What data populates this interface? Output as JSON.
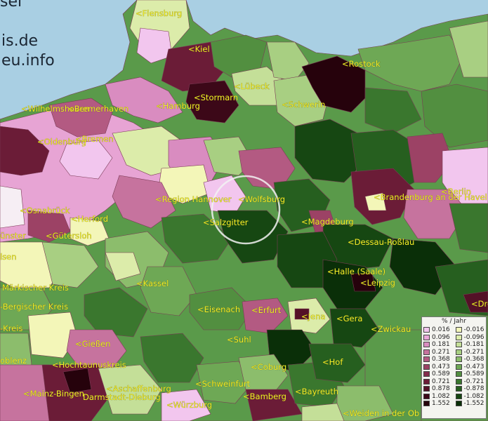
{
  "watermark": {
    "line1": "sel",
    "line2": "is.de",
    "line3": "eu.info"
  },
  "legend": {
    "title": "% / Jahr",
    "positive": [
      {
        "value": "0.016",
        "color": "#f2c6ee"
      },
      {
        "value": "0.096",
        "color": "#e8a6d8"
      },
      {
        "value": "0.181",
        "color": "#d98cc0"
      },
      {
        "value": "0.271",
        "color": "#c6739e"
      },
      {
        "value": "0.368",
        "color": "#b35a82"
      },
      {
        "value": "0.473",
        "color": "#9c4265"
      },
      {
        "value": "0.589",
        "color": "#842c4c"
      },
      {
        "value": "0.721",
        "color": "#6b1c37"
      },
      {
        "value": "0.878",
        "color": "#541127"
      },
      {
        "value": "1.082",
        "color": "#3c0818"
      },
      {
        "value": "1.552",
        "color": "#26020c"
      }
    ],
    "negative": [
      {
        "value": "-0.016",
        "color": "#f3f6b8"
      },
      {
        "value": "-0.096",
        "color": "#dcecaa"
      },
      {
        "value": "-0.181",
        "color": "#c4df98"
      },
      {
        "value": "-0.271",
        "color": "#a8cf82"
      },
      {
        "value": "-0.368",
        "color": "#8cbd6c"
      },
      {
        "value": "-0.473",
        "color": "#6ea855"
      },
      {
        "value": "-0.589",
        "color": "#528f40"
      },
      {
        "value": "-0.721",
        "color": "#3a772e"
      },
      {
        "value": "-0.878",
        "color": "#265f1f"
      },
      {
        "value": "-1.082",
        "color": "#164712"
      },
      {
        "value": "-1.552",
        "color": "#0a2f08"
      }
    ]
  },
  "cities": [
    "<Flensburg",
    "<Kiel",
    "<Rostock",
    "<Lübeck",
    "<Stormarn",
    "<Hamburg",
    "<Schwerin",
    "<Wilhelmshaven",
    "<Bremerhaven",
    "<Bremen",
    "<Oldenburg",
    "<Berlin",
    "<Region Hannover",
    "<Wolfsburg",
    "<Brandenburg an der Havel",
    "<Osnabrück",
    "<Herford",
    "<Salzgitter",
    "<Magdeburg",
    "ünster",
    "<Gütersloh",
    "<Dessau-Roßlau",
    "lsen",
    "<Halle (Saale)",
    "Märkischer Kreis",
    "<Kassel",
    "<Leipzig",
    "-Bergischer Kreis",
    "<Eisenach",
    "<Erfurt",
    "<Dre",
    "<Jena",
    "<Gera",
    "-Kreis",
    "<Suhl",
    "<Zwickau",
    "<Gießen",
    "oblenz",
    "<Hochtaunuskreis",
    "<Coburg",
    "<Hof",
    "<Schweinfurt",
    "<Aschaffenburg",
    "<Mainz-Bingen",
    "Darmstadt-Dieburg",
    "<Bamberg",
    "<Bayreuth",
    "<Würzburg",
    "<Weiden in der Ob"
  ]
}
